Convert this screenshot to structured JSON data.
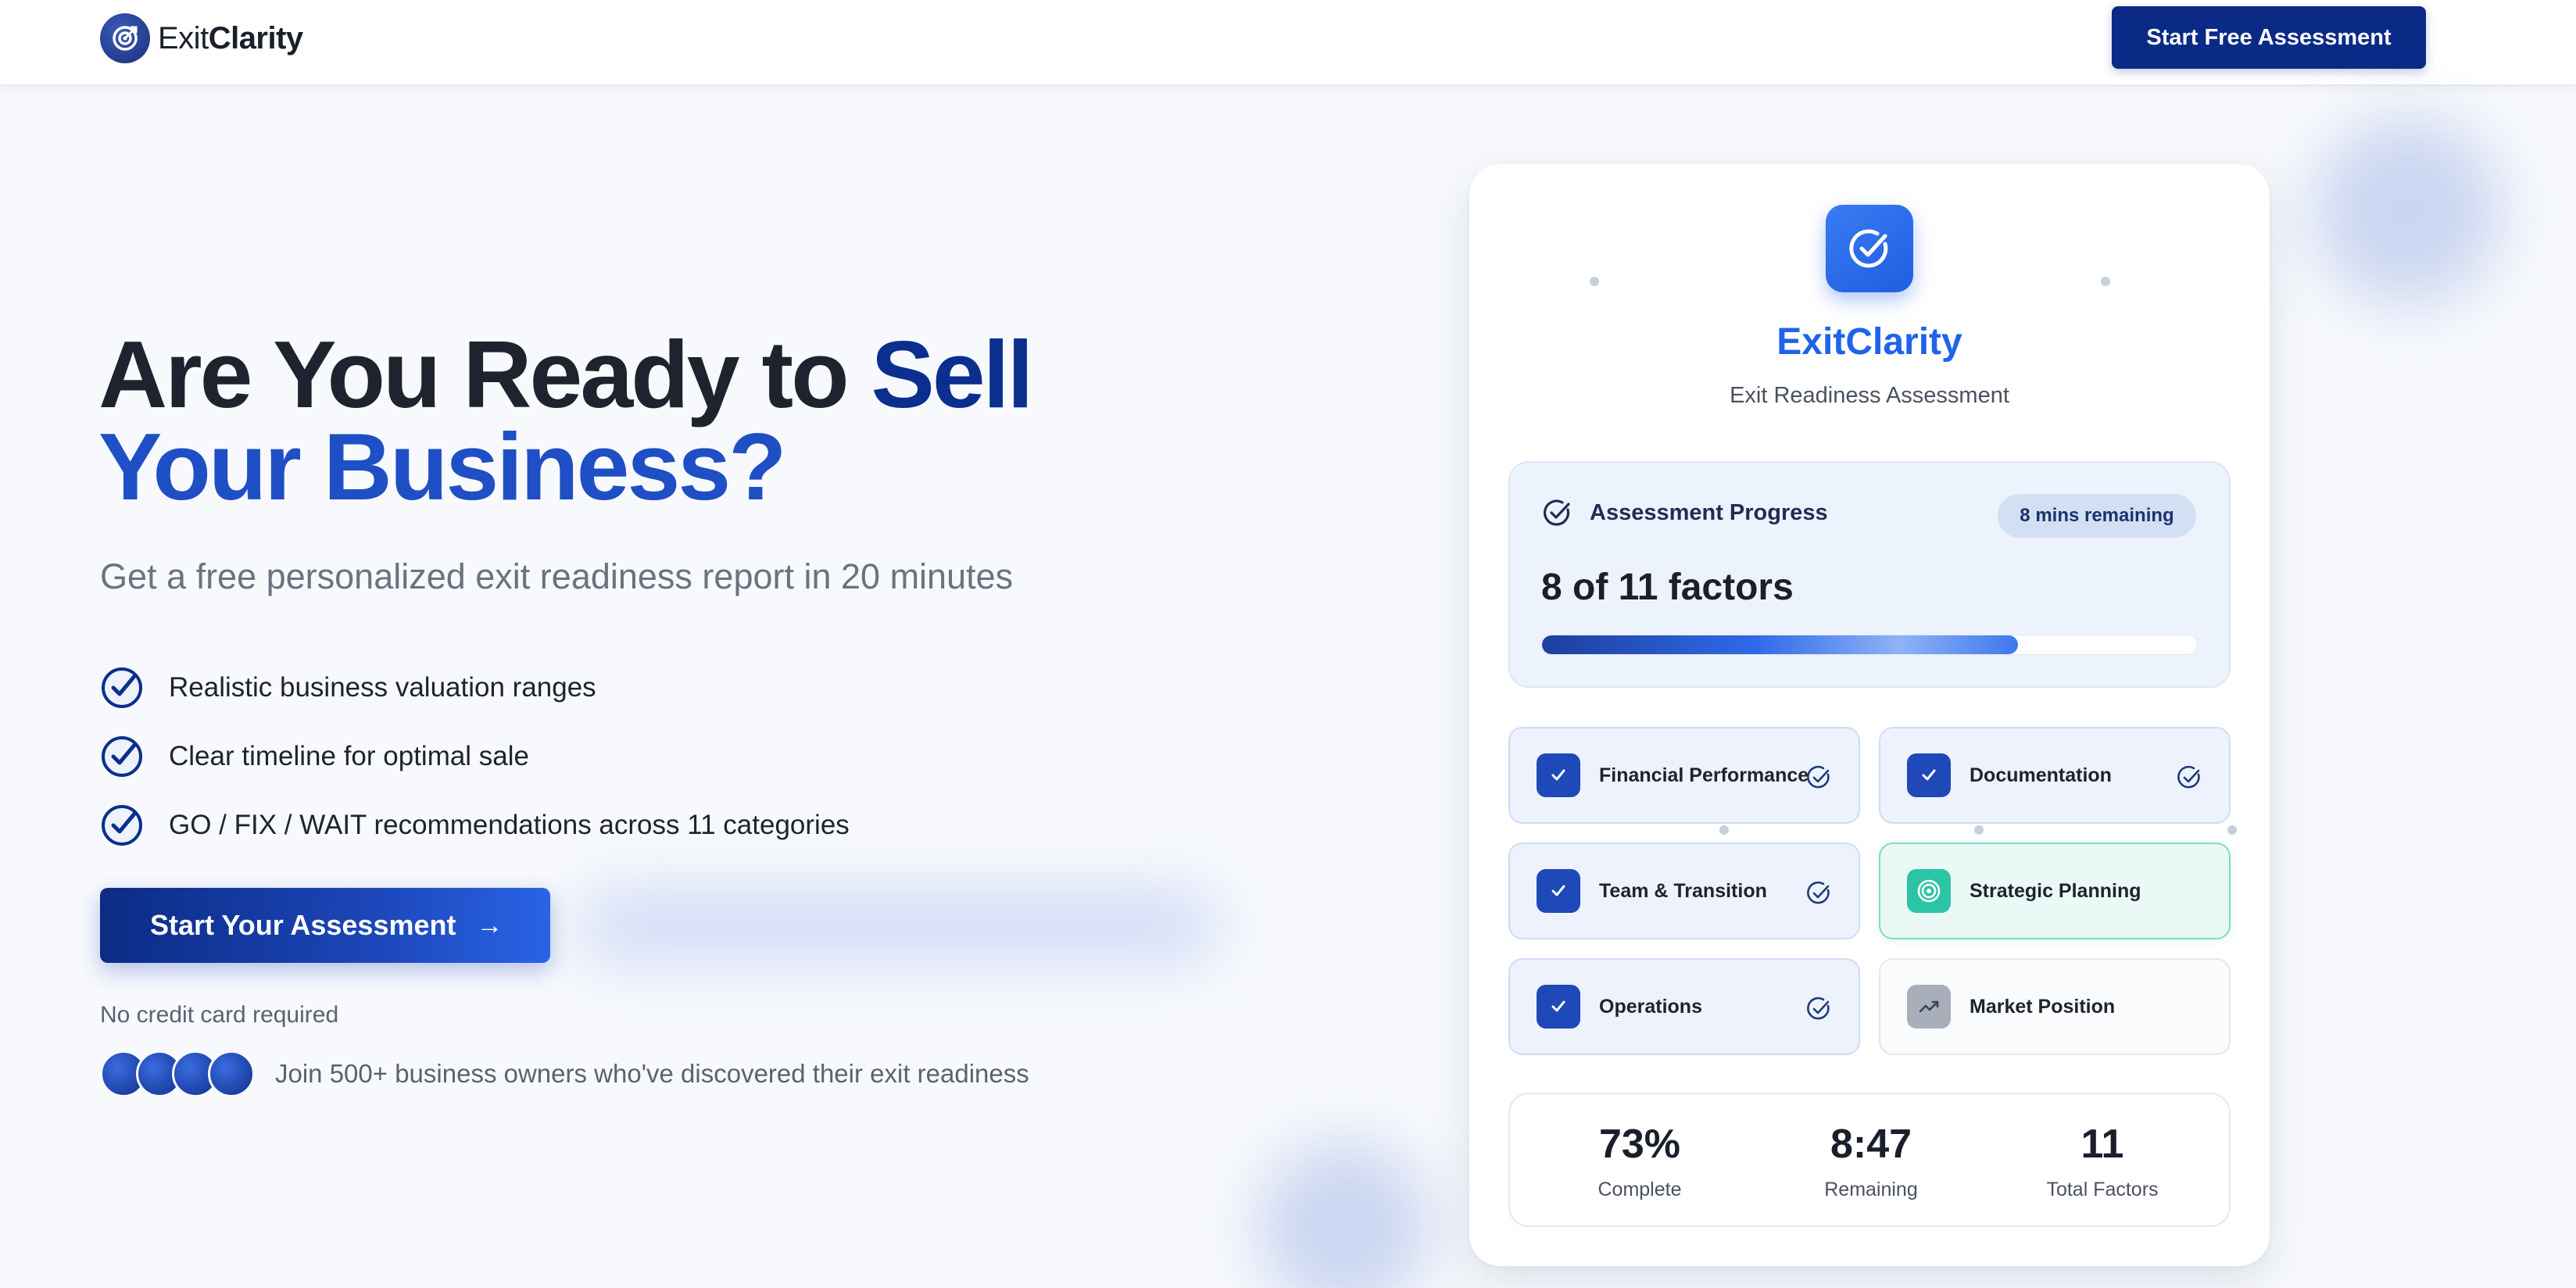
{
  "nav": {
    "logo_regular": "Exit",
    "logo_bold": "Clarity",
    "cta_label": "Start Free Assessment"
  },
  "hero": {
    "title_part1": "Are You Ready to ",
    "title_accent1": "Sell",
    "title_accent2": "Your Business?",
    "subtitle": "Get a free personalized exit readiness report in 20 minutes",
    "features": [
      "Realistic business valuation ranges",
      "Clear timeline for optimal sale",
      "GO / FIX / WAIT recommendations across 11 categories"
    ],
    "cta_label": "Start Your Assessment",
    "no_credit_card": "No credit card required",
    "social_proof": "Join 500+ business owners who've discovered their exit readiness"
  },
  "card": {
    "title": "ExitClarity",
    "subtitle": "Exit Readiness Assessment",
    "progress": {
      "label": "Assessment Progress",
      "badge": "8 mins remaining",
      "count": "8 of 11 factors",
      "fraction": 0.727
    },
    "factors": [
      {
        "label": "Financial Performance",
        "state": "complete",
        "icon": "check-icon"
      },
      {
        "label": "Documentation",
        "state": "complete",
        "icon": "check-icon"
      },
      {
        "label": "Team & Transition",
        "state": "complete",
        "icon": "check-icon"
      },
      {
        "label": "Strategic Planning",
        "state": "active",
        "icon": "target-icon"
      },
      {
        "label": "Operations",
        "state": "complete",
        "icon": "check-icon"
      },
      {
        "label": "Market Position",
        "state": "pending",
        "icon": "trending-up-icon"
      }
    ],
    "stats": [
      {
        "value": "73%",
        "label": "Complete"
      },
      {
        "value": "8:47",
        "label": "Remaining"
      },
      {
        "value": "11",
        "label": "Total Factors"
      }
    ]
  },
  "colors": {
    "brand_navy": "#0a2a86",
    "brand_blue": "#1f63e8",
    "active_teal": "#2bc4a6"
  }
}
